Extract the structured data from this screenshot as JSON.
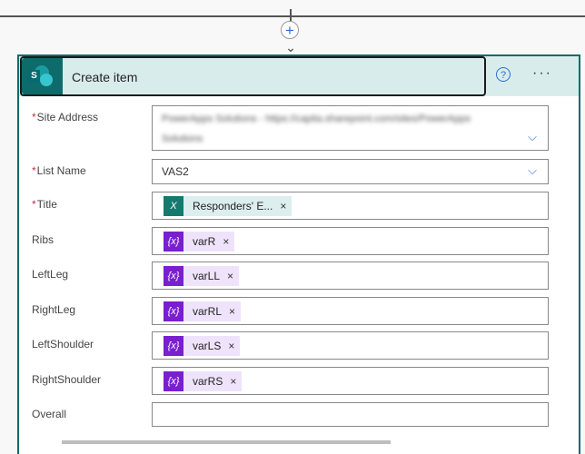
{
  "action": {
    "title": "Create item",
    "help_icon": "help-icon",
    "more_icon": "more-icon"
  },
  "fields": [
    {
      "label": "Site Address",
      "required": true,
      "value_line1": "PowerApps Solutions - https://capita.sharepoint.com/sites/PowerApps",
      "value_line2": "Solutions"
    },
    {
      "label": "List Name",
      "required": true,
      "value": "VAS2"
    },
    {
      "label": "Title",
      "required": true,
      "token": "Responders' E..."
    },
    {
      "label": "Ribs",
      "token": "varR"
    },
    {
      "label": "LeftLeg",
      "token": "varLL"
    },
    {
      "label": "RightLeg",
      "token": "varRL"
    },
    {
      "label": "LeftShoulder",
      "token": "varLS"
    },
    {
      "label": "RightShoulder",
      "token": "varRS"
    },
    {
      "label": "Overall",
      "value": ""
    }
  ],
  "glyphs": {
    "required": "*",
    "remove": "×",
    "var": "{x}",
    "plus": "+",
    "chevron": "⌵",
    "help": "?",
    "more": "···"
  }
}
